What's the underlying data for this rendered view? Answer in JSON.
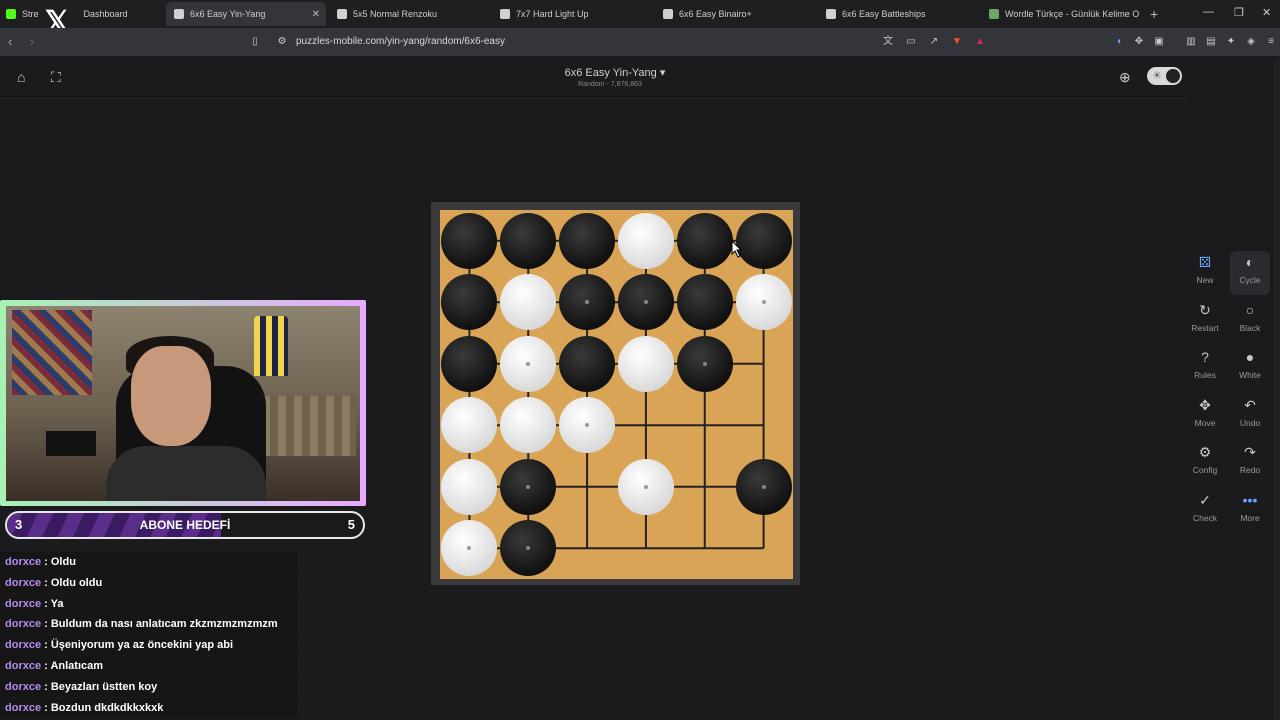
{
  "browser": {
    "tabs": [
      {
        "label": "Stre",
        "extra": "Dashboard",
        "active": false,
        "favicon_color": "#53fc18"
      },
      {
        "label": "6x6 Easy Yin-Yang",
        "active": true,
        "favicon_color": "#d0d0d0"
      },
      {
        "label": "5x5 Normal Renzoku",
        "active": false,
        "favicon_color": "#d0d0d0"
      },
      {
        "label": "7x7 Hard Light Up",
        "active": false,
        "favicon_color": "#d0d0d0"
      },
      {
        "label": "6x6 Easy Binairo+",
        "active": false,
        "favicon_color": "#d0d0d0"
      },
      {
        "label": "6x6 Easy Battleships",
        "active": false,
        "favicon_color": "#d0d0d0"
      },
      {
        "label": "Wordle Türkçe - Günlük Kelime Oyu",
        "active": false,
        "favicon_color": "#6aaa64"
      }
    ],
    "url": "puzzles-mobile.com/yin-yang/random/6x6-easy"
  },
  "header": {
    "title": "6x6 Easy Yin-Yang",
    "subtitle": "Random - 7,876,863"
  },
  "board": {
    "size": 6,
    "cells": [
      [
        "B",
        "B",
        "B",
        "W",
        "B",
        "B"
      ],
      [
        "B",
        "W",
        "b",
        "b",
        "B",
        "w"
      ],
      [
        "B",
        "w",
        "B",
        "W",
        "b",
        ""
      ],
      [
        "W",
        "W",
        "w",
        "",
        "",
        ""
      ],
      [
        "W",
        "b",
        "",
        "w",
        "",
        "b"
      ],
      [
        "w",
        "b",
        "",
        "",
        "",
        ""
      ]
    ]
  },
  "sidebar": {
    "buttons": [
      {
        "label": "New",
        "icon": "dice-icon"
      },
      {
        "label": "Cycle",
        "icon": "cycle-stones-icon",
        "selected": true
      },
      {
        "label": "Restart",
        "icon": "restart-icon"
      },
      {
        "label": "Black",
        "icon": "black-stone-icon"
      },
      {
        "label": "Rules",
        "icon": "question-icon"
      },
      {
        "label": "White",
        "icon": "white-stone-icon"
      },
      {
        "label": "Move",
        "icon": "move-icon"
      },
      {
        "label": "Undo",
        "icon": "undo-icon"
      },
      {
        "label": "Config",
        "icon": "gear-icon"
      },
      {
        "label": "Redo",
        "icon": "redo-icon"
      },
      {
        "label": "Check",
        "icon": "check-icon"
      },
      {
        "label": "More",
        "icon": "more-icon"
      }
    ]
  },
  "stream": {
    "goal": {
      "current": "3",
      "title": "ABONE HEDEFİ",
      "target": "5",
      "progress": 0.6
    },
    "chat": [
      {
        "user": "dorxce",
        "msg": "Oldu"
      },
      {
        "user": "dorxce",
        "msg": "Oldu oldu"
      },
      {
        "user": "dorxce",
        "msg": "Ya"
      },
      {
        "user": "dorxce",
        "msg": "Buldum da nası anlatıcam zkzmzmzmzmzm"
      },
      {
        "user": "dorxce",
        "msg": "Üşeniyorum ya az öncekini yap abi"
      },
      {
        "user": "dorxce",
        "msg": "Anlatıcam"
      },
      {
        "user": "dorxce",
        "msg": "Beyazları üstten koy"
      },
      {
        "user": "dorxce",
        "msg": "Bozdun dkdkdkkxkxk"
      }
    ]
  }
}
